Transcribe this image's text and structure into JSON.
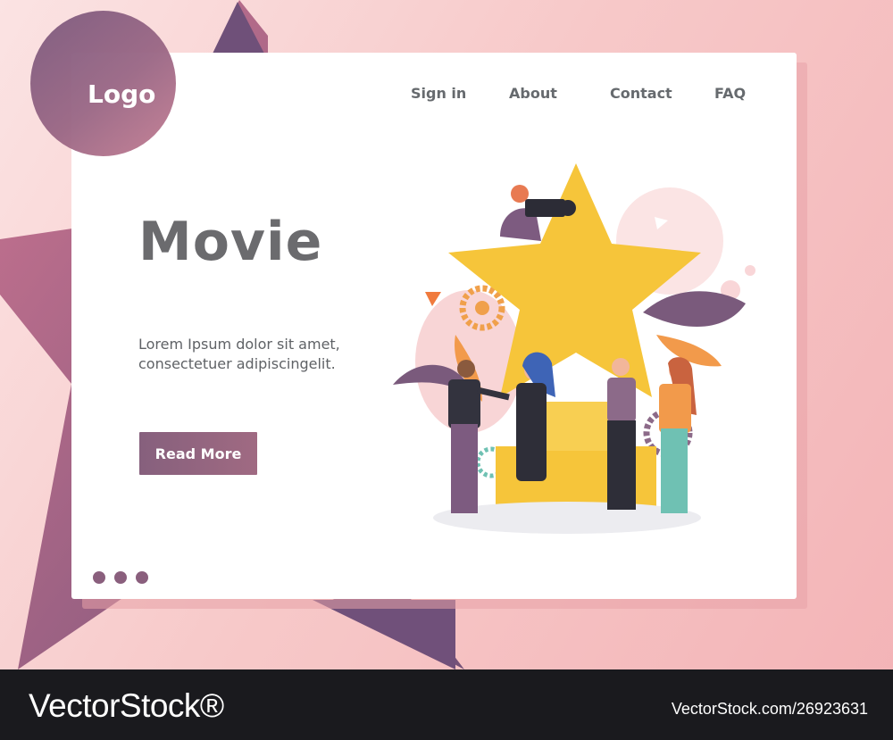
{
  "brand": {
    "logo_label": "Logo"
  },
  "nav": {
    "items": [
      {
        "label": "Sign in"
      },
      {
        "label": "About"
      },
      {
        "label": "Contact"
      },
      {
        "label": "FAQ"
      }
    ]
  },
  "hero": {
    "title": "Movie",
    "description_line1": "Lorem Ipsum dolor sit amet,",
    "description_line2": "consectetuer adipiscingelit.",
    "cta_label": "Read More"
  },
  "pagination": {
    "dot_count": 3
  },
  "colors": {
    "accent_purple": "#86607d",
    "star_yellow": "#f6c53a",
    "background_pink": "#f7c9c9",
    "footer_dark": "#1a1a1e"
  },
  "watermark": {
    "brand": "VectorStock®",
    "stock_id": "VectorStock.com/26923631"
  }
}
